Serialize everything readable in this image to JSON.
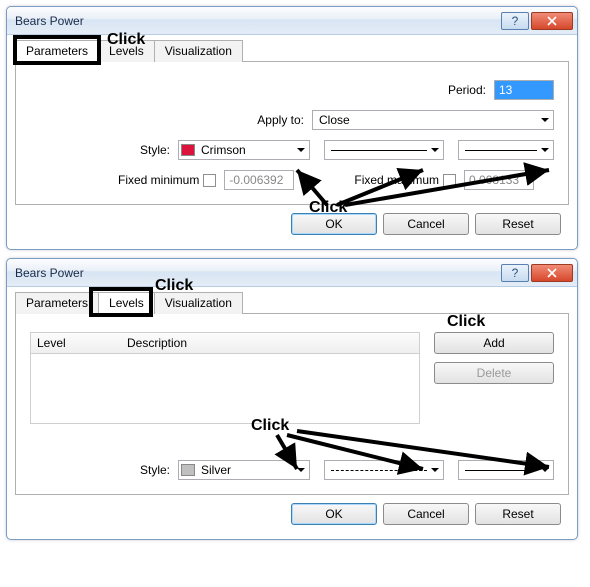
{
  "dialog1": {
    "title": "Bears Power",
    "tabs": {
      "parameters": "Parameters",
      "levels": "Levels",
      "visualization": "Visualization"
    },
    "period_label": "Period:",
    "period_value": "13",
    "applyto_label": "Apply to:",
    "applyto_value": "Close",
    "style_label": "Style:",
    "style_color_name": "Crimson",
    "fixedmin_label": "Fixed minimum",
    "fixedmin_value": "-0.006392",
    "fixedmax_label": "Fixed maximum",
    "fixedmax_value": "0.008133",
    "buttons": {
      "ok": "OK",
      "cancel": "Cancel",
      "reset": "Reset"
    }
  },
  "dialog2": {
    "title": "Bears Power",
    "tabs": {
      "parameters": "Parameters",
      "levels": "Levels",
      "visualization": "Visualization"
    },
    "list": {
      "col_level": "Level",
      "col_desc": "Description"
    },
    "add_label": "Add",
    "delete_label": "Delete",
    "style_label": "Style:",
    "style_color_name": "Silver",
    "buttons": {
      "ok": "OK",
      "cancel": "Cancel",
      "reset": "Reset"
    }
  },
  "annotations": {
    "click": "Click"
  }
}
